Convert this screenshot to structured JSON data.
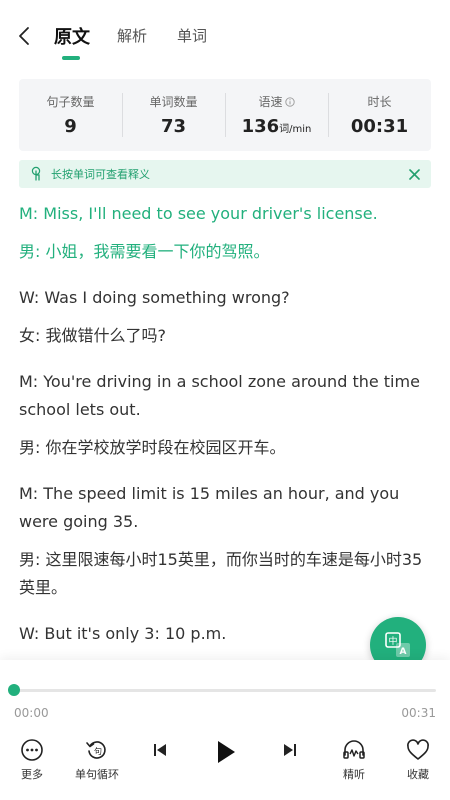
{
  "header": {
    "tabs": [
      {
        "label": "原文",
        "active": true
      },
      {
        "label": "解析",
        "active": false
      },
      {
        "label": "单词",
        "active": false
      }
    ]
  },
  "stats": [
    {
      "label": "句子数量",
      "value": "9",
      "unit": ""
    },
    {
      "label": "单词数量",
      "value": "73",
      "unit": ""
    },
    {
      "label": "语速",
      "value": "136",
      "unit": "词/min",
      "has_info": true
    },
    {
      "label": "时长",
      "value": "00:31",
      "unit": ""
    }
  ],
  "tip": {
    "text": "长按单词可查看释义"
  },
  "transcript": [
    {
      "en": "M: Miss, I'll need to see your driver's license.",
      "zh": "男: 小姐，我需要看一下你的驾照。",
      "active": true
    },
    {
      "en": "W: Was I doing something wrong?",
      "zh": "女: 我做错什么了吗?",
      "active": false
    },
    {
      "en": "M: You're driving in a school zone around the time school lets out.",
      "zh": "男: 你在学校放学时段在校园区开车。",
      "active": false
    },
    {
      "en": "M: The speed limit is 15 miles an hour, and you were going 35.",
      "zh": "男: 这里限速每小时15英里，而你当时的车速是每小时35英里。",
      "active": false
    },
    {
      "en": "W: But it's only 3: 10 p.m.",
      "zh": "",
      "active": false
    }
  ],
  "player": {
    "progress": 0.0,
    "current_time": "00:00",
    "total_time": "00:31",
    "controls": {
      "more": "更多",
      "loop": "单句循环",
      "intensive": "精听",
      "favorite": "收藏"
    }
  },
  "colors": {
    "accent": "#22b07d",
    "tip_bg": "#e6f6ef",
    "stats_bg": "#f4f5f7"
  }
}
